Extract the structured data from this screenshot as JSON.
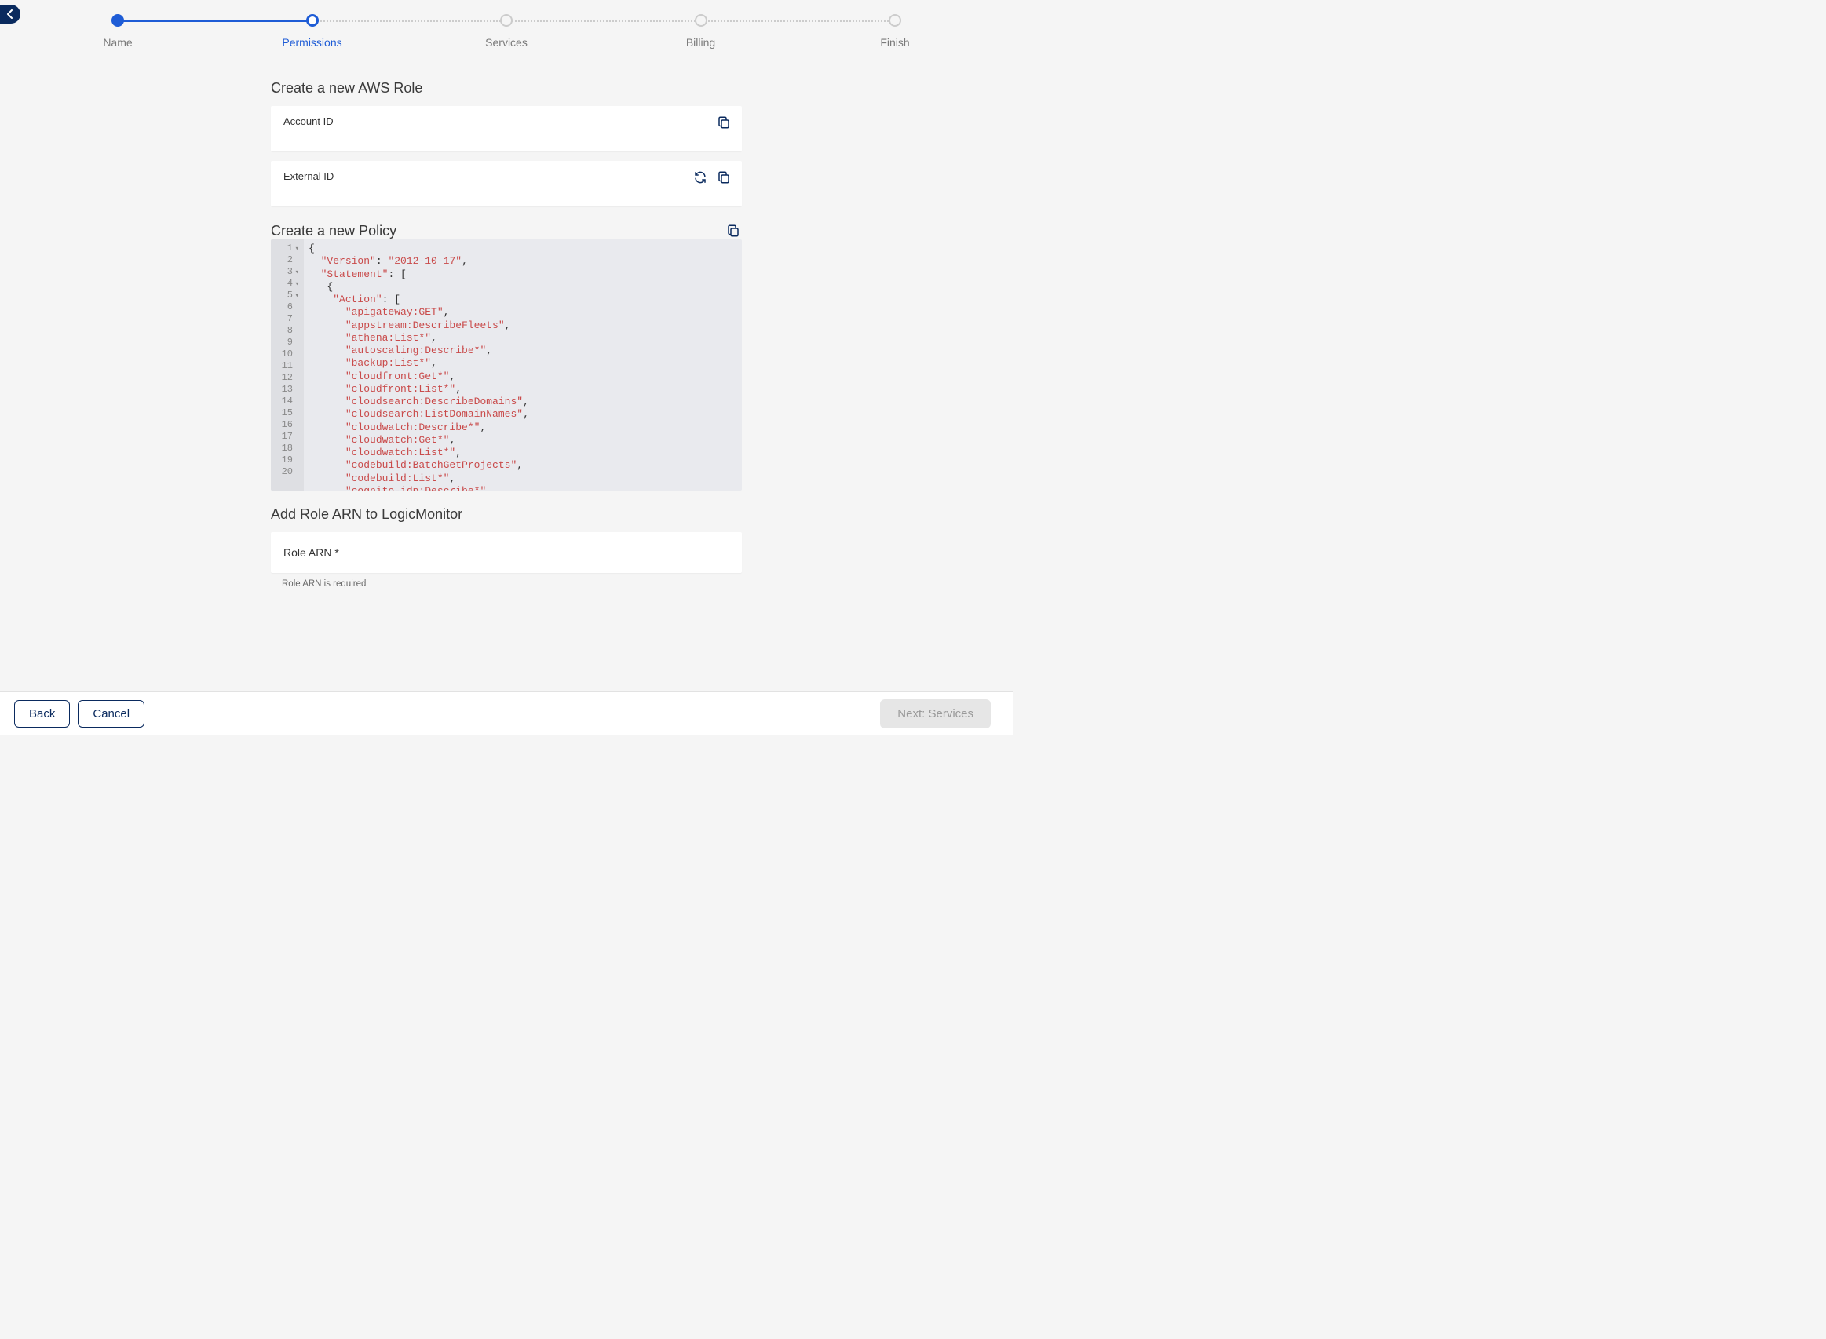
{
  "stepper": {
    "steps": [
      {
        "label": "Name",
        "state": "completed"
      },
      {
        "label": "Permissions",
        "state": "current"
      },
      {
        "label": "Services",
        "state": "upcoming"
      },
      {
        "label": "Billing",
        "state": "upcoming"
      },
      {
        "label": "Finish",
        "state": "upcoming"
      }
    ]
  },
  "sections": {
    "create_role_title": "Create a new AWS Role",
    "account_id_label": "Account ID",
    "external_id_label": "External ID",
    "create_policy_title": "Create a new Policy",
    "add_arn_title": "Add Role ARN to LogicMonitor",
    "role_arn_label": "Role ARN *",
    "role_arn_helper": "Role ARN is required"
  },
  "policy_editor": {
    "fold_lines": [
      1,
      3,
      4,
      5
    ],
    "lines": [
      {
        "n": 1,
        "tokens": [
          {
            "t": "{",
            "c": "punc"
          }
        ]
      },
      {
        "n": 2,
        "tokens": [
          {
            "t": "  ",
            "c": "punc"
          },
          {
            "t": "\"Version\"",
            "c": "str"
          },
          {
            "t": ": ",
            "c": "punc"
          },
          {
            "t": "\"2012-10-17\"",
            "c": "str"
          },
          {
            "t": ",",
            "c": "punc"
          }
        ]
      },
      {
        "n": 3,
        "tokens": [
          {
            "t": "  ",
            "c": "punc"
          },
          {
            "t": "\"Statement\"",
            "c": "str"
          },
          {
            "t": ": [",
            "c": "punc"
          }
        ]
      },
      {
        "n": 4,
        "tokens": [
          {
            "t": "   {",
            "c": "punc"
          }
        ]
      },
      {
        "n": 5,
        "tokens": [
          {
            "t": "    ",
            "c": "punc"
          },
          {
            "t": "\"Action\"",
            "c": "str"
          },
          {
            "t": ": [",
            "c": "punc"
          }
        ]
      },
      {
        "n": 6,
        "tokens": [
          {
            "t": "      ",
            "c": "punc"
          },
          {
            "t": "\"apigateway:GET\"",
            "c": "str"
          },
          {
            "t": ",",
            "c": "punc"
          }
        ]
      },
      {
        "n": 7,
        "tokens": [
          {
            "t": "      ",
            "c": "punc"
          },
          {
            "t": "\"appstream:DescribeFleets\"",
            "c": "str"
          },
          {
            "t": ",",
            "c": "punc"
          }
        ]
      },
      {
        "n": 8,
        "tokens": [
          {
            "t": "      ",
            "c": "punc"
          },
          {
            "t": "\"athena:List*\"",
            "c": "str"
          },
          {
            "t": ",",
            "c": "punc"
          }
        ]
      },
      {
        "n": 9,
        "tokens": [
          {
            "t": "      ",
            "c": "punc"
          },
          {
            "t": "\"autoscaling:Describe*\"",
            "c": "str"
          },
          {
            "t": ",",
            "c": "punc"
          }
        ]
      },
      {
        "n": 10,
        "tokens": [
          {
            "t": "      ",
            "c": "punc"
          },
          {
            "t": "\"backup:List*\"",
            "c": "str"
          },
          {
            "t": ",",
            "c": "punc"
          }
        ]
      },
      {
        "n": 11,
        "tokens": [
          {
            "t": "      ",
            "c": "punc"
          },
          {
            "t": "\"cloudfront:Get*\"",
            "c": "str"
          },
          {
            "t": ",",
            "c": "punc"
          }
        ]
      },
      {
        "n": 12,
        "tokens": [
          {
            "t": "      ",
            "c": "punc"
          },
          {
            "t": "\"cloudfront:List*\"",
            "c": "str"
          },
          {
            "t": ",",
            "c": "punc"
          }
        ]
      },
      {
        "n": 13,
        "tokens": [
          {
            "t": "      ",
            "c": "punc"
          },
          {
            "t": "\"cloudsearch:DescribeDomains\"",
            "c": "str"
          },
          {
            "t": ",",
            "c": "punc"
          }
        ]
      },
      {
        "n": 14,
        "tokens": [
          {
            "t": "      ",
            "c": "punc"
          },
          {
            "t": "\"cloudsearch:ListDomainNames\"",
            "c": "str"
          },
          {
            "t": ",",
            "c": "punc"
          }
        ]
      },
      {
        "n": 15,
        "tokens": [
          {
            "t": "      ",
            "c": "punc"
          },
          {
            "t": "\"cloudwatch:Describe*\"",
            "c": "str"
          },
          {
            "t": ",",
            "c": "punc"
          }
        ]
      },
      {
        "n": 16,
        "tokens": [
          {
            "t": "      ",
            "c": "punc"
          },
          {
            "t": "\"cloudwatch:Get*\"",
            "c": "str"
          },
          {
            "t": ",",
            "c": "punc"
          }
        ]
      },
      {
        "n": 17,
        "tokens": [
          {
            "t": "      ",
            "c": "punc"
          },
          {
            "t": "\"cloudwatch:List*\"",
            "c": "str"
          },
          {
            "t": ",",
            "c": "punc"
          }
        ]
      },
      {
        "n": 18,
        "tokens": [
          {
            "t": "      ",
            "c": "punc"
          },
          {
            "t": "\"codebuild:BatchGetProjects\"",
            "c": "str"
          },
          {
            "t": ",",
            "c": "punc"
          }
        ]
      },
      {
        "n": 19,
        "tokens": [
          {
            "t": "      ",
            "c": "punc"
          },
          {
            "t": "\"codebuild:List*\"",
            "c": "str"
          },
          {
            "t": ",",
            "c": "punc"
          }
        ]
      },
      {
        "n": 20,
        "tokens": [
          {
            "t": "      ",
            "c": "punc"
          },
          {
            "t": "\"cognito-idp:Describe*\"",
            "c": "str"
          },
          {
            "t": ",",
            "c": "punc"
          }
        ]
      }
    ]
  },
  "footer": {
    "back_label": "Back",
    "cancel_label": "Cancel",
    "next_label": "Next: Services"
  },
  "icons": {
    "copy": "copy-icon",
    "refresh": "refresh-icon"
  }
}
